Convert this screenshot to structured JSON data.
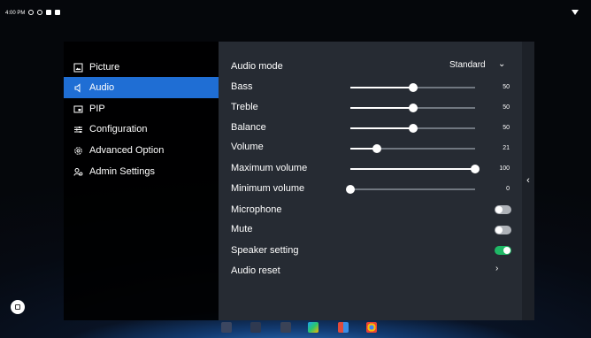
{
  "status_bar": {
    "time": "4:00 PM"
  },
  "menu": {
    "items": [
      {
        "label": "Picture",
        "icon": "picture-icon"
      },
      {
        "label": "Audio",
        "icon": "speaker-icon"
      },
      {
        "label": "PIP",
        "icon": "pip-icon"
      },
      {
        "label": "Configuration",
        "icon": "sliders-icon"
      },
      {
        "label": "Advanced Option",
        "icon": "gear-icon"
      },
      {
        "label": "Admin Settings",
        "icon": "admin-icon"
      }
    ],
    "active": "Audio"
  },
  "audio": {
    "audio_mode": {
      "label": "Audio mode",
      "value": "Standard"
    },
    "sliders": [
      {
        "label": "Bass",
        "value": "50",
        "level": 50
      },
      {
        "label": "Treble",
        "value": "50",
        "level": 50
      },
      {
        "label": "Balance",
        "value": "50",
        "level": 50
      },
      {
        "label": "Volume",
        "value": "21",
        "level": 21
      },
      {
        "label": "Maximum volume",
        "value": "100",
        "level": 100
      },
      {
        "label": "Minimum volume",
        "value": "0",
        "level": 0
      }
    ],
    "toggles": [
      {
        "label": "Microphone",
        "on": false
      },
      {
        "label": "Mute",
        "on": false
      },
      {
        "label": "Speaker setting",
        "on": true
      }
    ],
    "audio_reset": {
      "label": "Audio reset"
    }
  },
  "colors": {
    "accent": "#1f6ed4",
    "toggle_on": "#1fb866",
    "panel": "#262b33"
  },
  "dock_apps": [
    "gallery-app-icon",
    "files-app-icon",
    "settings-app-icon",
    "play-store-app-icon",
    "apps-grid-icon",
    "chrome-app-icon"
  ]
}
